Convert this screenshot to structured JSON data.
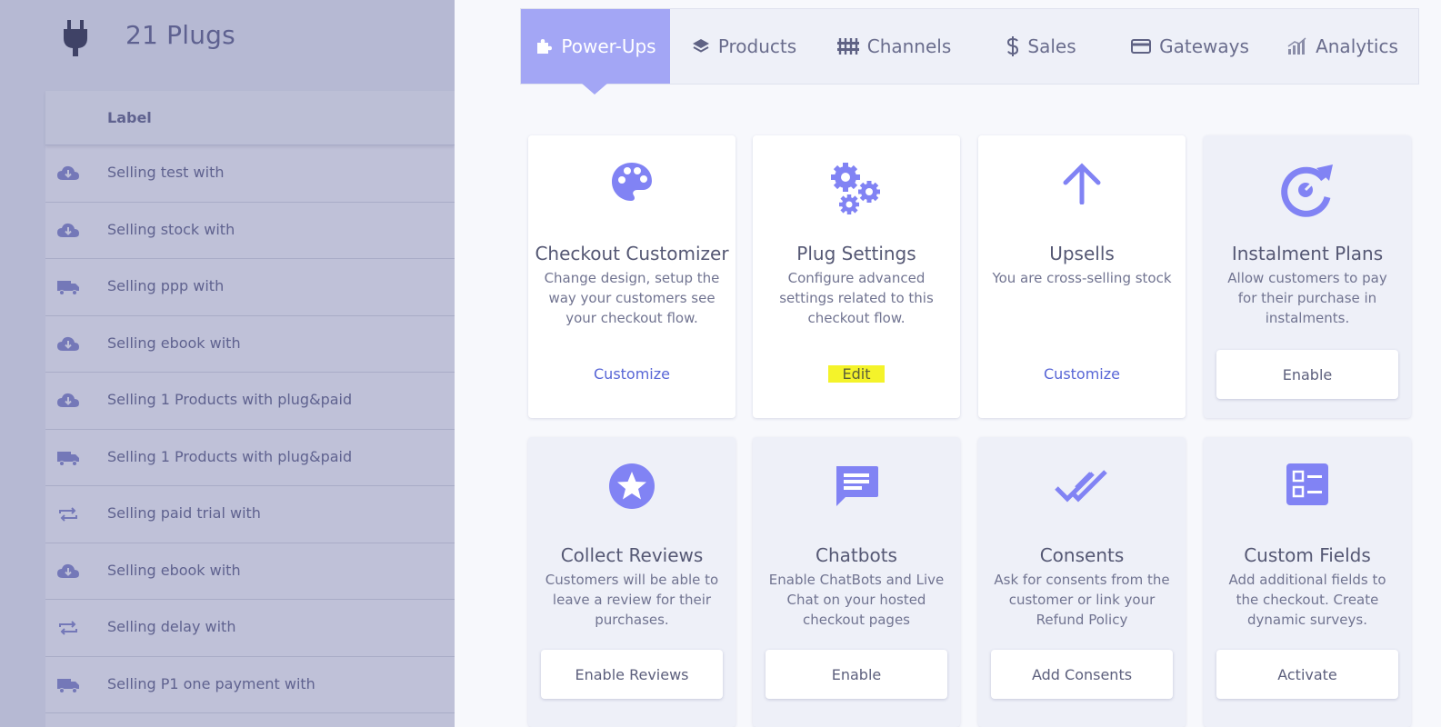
{
  "left_panel": {
    "title": "21 Plugs",
    "column_header": "Label",
    "rows": [
      {
        "icon": "cloud-download-icon",
        "label": "Selling test with"
      },
      {
        "icon": "cloud-download-icon",
        "label": "Selling stock with"
      },
      {
        "icon": "truck-icon",
        "label": "Selling ppp with"
      },
      {
        "icon": "cloud-download-icon",
        "label": "Selling ebook with"
      },
      {
        "icon": "cloud-download-icon",
        "label": "Selling 1 Products with plug&paid"
      },
      {
        "icon": "truck-icon",
        "label": "Selling 1 Products with plug&paid"
      },
      {
        "icon": "repeat-icon",
        "label": "Selling paid trial with"
      },
      {
        "icon": "cloud-download-icon",
        "label": "Selling ebook with"
      },
      {
        "icon": "repeat-icon",
        "label": "Selling delay with"
      },
      {
        "icon": "truck-icon",
        "label": "Selling P1 one payment with"
      }
    ]
  },
  "tabs": [
    {
      "label": "Power-Ups",
      "icon": "puzzle-icon",
      "active": true
    },
    {
      "label": "Products",
      "icon": "layers-icon",
      "active": false
    },
    {
      "label": "Channels",
      "icon": "channels-icon",
      "active": false
    },
    {
      "label": "Sales",
      "icon": "dollar-icon",
      "active": false
    },
    {
      "label": "Gateways",
      "icon": "credit-card-icon",
      "active": false
    },
    {
      "label": "Analytics",
      "icon": "analytics-icon",
      "active": false
    }
  ],
  "cards": [
    {
      "title": "Checkout Customizer",
      "description": "Change design, setup the way your customers see your checkout flow.",
      "action": "Customize",
      "icon": "palette-icon"
    },
    {
      "title": "Plug Settings",
      "description": "Configure advanced settings related to this checkout flow.",
      "action": "Edit",
      "icon": "gears-icon"
    },
    {
      "title": "Upsells",
      "description": "You are cross-selling stock",
      "action": "Customize",
      "icon": "arrow-up-icon"
    },
    {
      "title": "Instalment Plans",
      "description": "Allow customers to pay for their purchase in instalments.",
      "action": "Enable",
      "icon": "refresh-icon"
    },
    {
      "title": "Collect Reviews",
      "description": "Customers will be able to leave a review for their purchases.",
      "action": "Enable Reviews",
      "icon": "star-icon"
    },
    {
      "title": "Chatbots",
      "description": "Enable ChatBots and Live Chat on your hosted checkout pages",
      "action": "Enable",
      "icon": "chat-icon"
    },
    {
      "title": "Consents",
      "description": "Ask for consents from the customer or link your Refund Policy",
      "action": "Add Consents",
      "icon": "double-check-icon"
    },
    {
      "title": "Custom Fields",
      "description": "Add additional fields to the checkout. Create dynamic surveys.",
      "action": "Activate",
      "icon": "checklist-icon"
    }
  ],
  "colors": {
    "accent": "#8183f4",
    "active_tab": "#a3a6f5",
    "link": "#5866d6",
    "highlight": "#f4f32a",
    "overlay": "#b6b9d3"
  }
}
